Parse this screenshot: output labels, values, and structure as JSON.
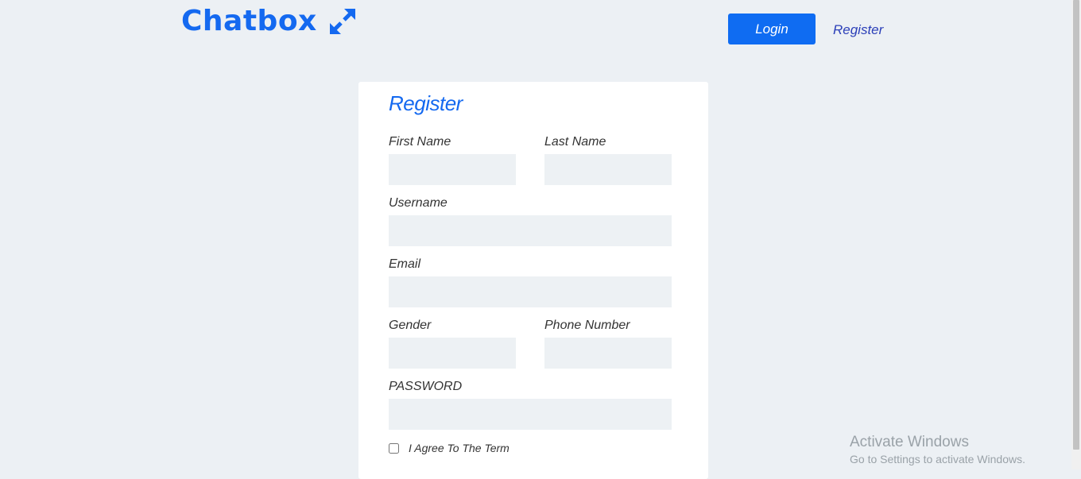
{
  "header": {
    "logo_text": "Chatbox",
    "logo_icon": "expand-arrows-icon",
    "login_label": "Login",
    "register_label": "Register"
  },
  "form": {
    "title": "Register",
    "first_name_label": "First Name",
    "last_name_label": "Last Name",
    "username_label": "Username",
    "email_label": "Email",
    "gender_label": "Gender",
    "phone_label": "Phone Number",
    "password_label": "PASSWORD",
    "terms_label": "I Agree To The Term",
    "terms_checked": false
  },
  "watermark": {
    "title": "Activate Windows",
    "subtitle": "Go to Settings to activate Windows."
  },
  "colors": {
    "accent": "#1469f0",
    "button": "#0f6cf2",
    "background": "#ecf0f4",
    "input_bg": "#edf1f4"
  }
}
